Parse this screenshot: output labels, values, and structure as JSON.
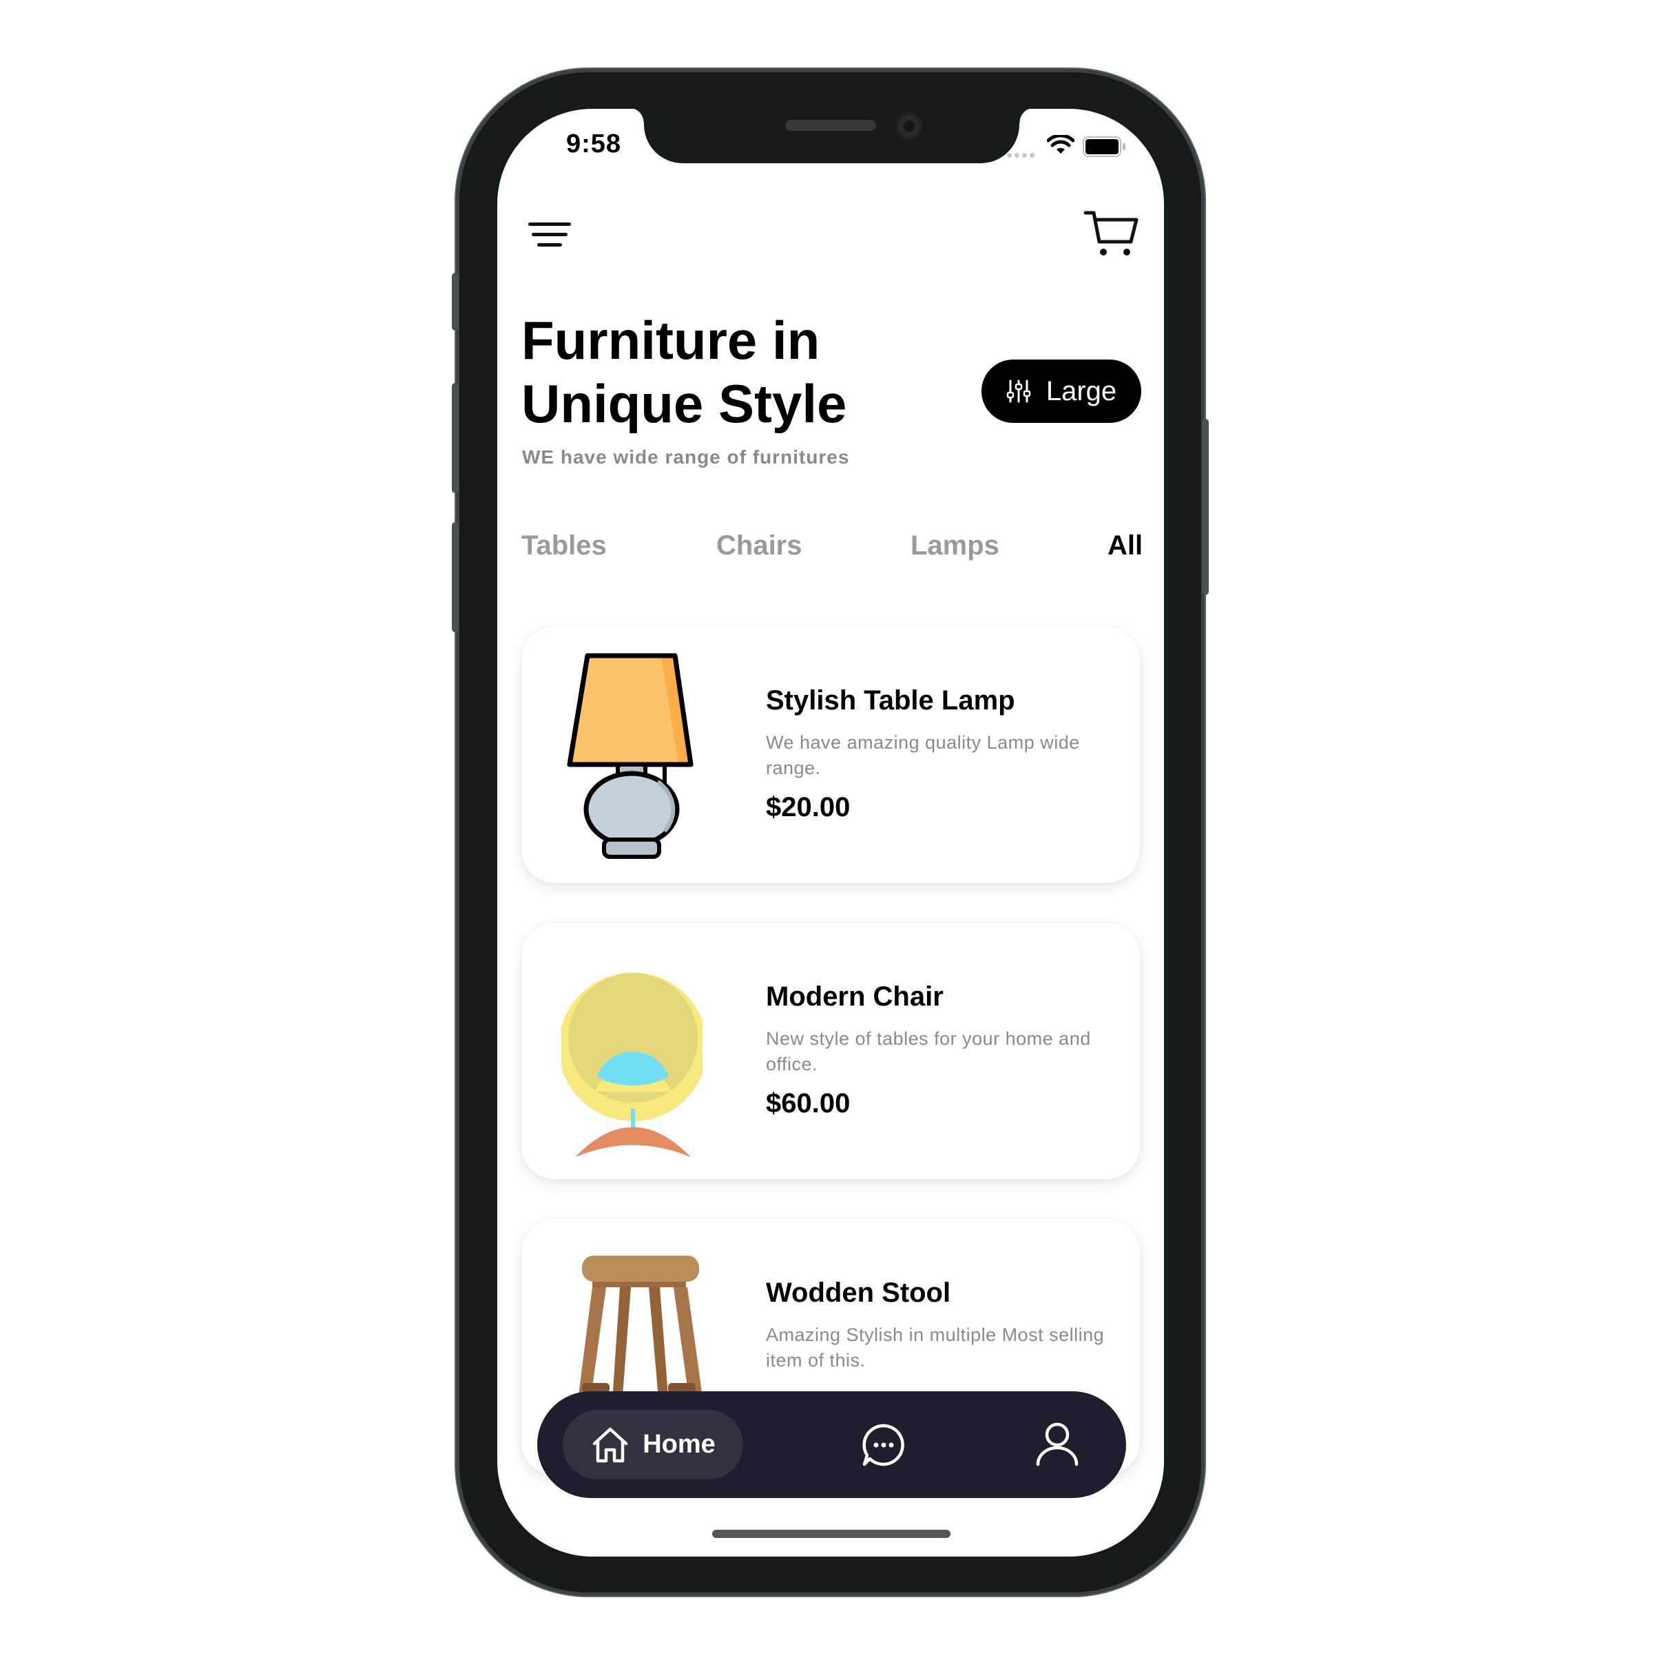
{
  "status_bar": {
    "time": "9:58"
  },
  "header": {
    "menu_icon": "hamburger-menu-icon",
    "cart_icon": "shopping-cart-icon",
    "title_line1": "Furniture in",
    "title_line2": "Unique Style",
    "subtitle": "WE have wide range of furnitures",
    "filter_label": "Large",
    "filter_icon": "sliders-icon"
  },
  "tabs": [
    {
      "label": "Tables",
      "active": false
    },
    {
      "label": "Chairs",
      "active": false
    },
    {
      "label": "Lamps",
      "active": false
    },
    {
      "label": "All",
      "active": true
    }
  ],
  "products": [
    {
      "name": "Stylish Table Lamp",
      "description": "We have amazing quality Lamp wide range.",
      "price": "$20.00",
      "icon": "table-lamp-icon"
    },
    {
      "name": "Modern Chair",
      "description": "New style of tables for your home and office.",
      "price": "$60.00",
      "icon": "ball-chair-icon"
    },
    {
      "name": "Wodden Stool",
      "description": "Amazing Stylish in multiple Most selling item of this.",
      "price": "",
      "icon": "wooden-stool-icon"
    }
  ],
  "bottom_nav": {
    "home_label": "Home",
    "home_icon": "home-icon",
    "chat_icon": "chat-bubble-icon",
    "profile_icon": "user-profile-icon"
  },
  "colors": {
    "primary": "#000000",
    "nav_background": "#201e2e",
    "nav_active_pill": "#33313f",
    "muted_text": "#8a8a8a",
    "lamp_shade": "#fcc36a",
    "chair_yellow": "#f7e97d",
    "stool_wood": "#a8754a"
  }
}
